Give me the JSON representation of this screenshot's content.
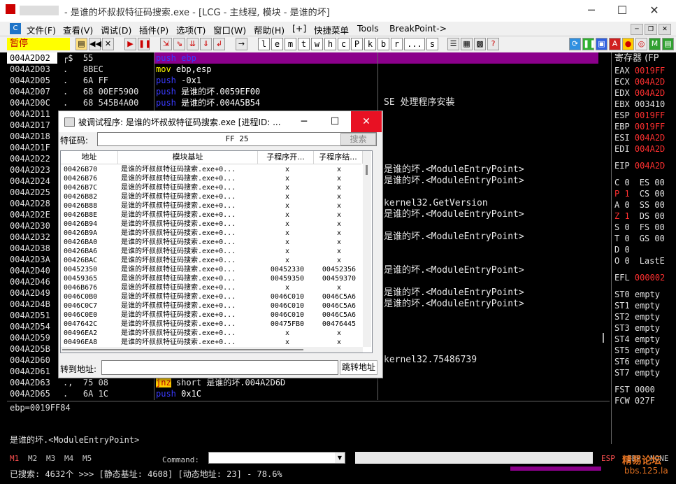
{
  "window": {
    "title": "- 是谁的坏叔叔特征码搜索.exe - [LCG - 主线程, 模块 - 是谁的坏]",
    "minimize": "─",
    "maximize": "☐",
    "close": "✕"
  },
  "menu": {
    "items": [
      "文件(F)",
      "查看(V)",
      "调试(D)",
      "插件(P)",
      "选项(T)",
      "窗口(W)",
      "帮助(H)",
      "[+]",
      "快捷菜单",
      "Tools",
      "BreakPoint->"
    ],
    "app_icon": "C"
  },
  "toolbar": {
    "status": "暂停",
    "letters": [
      "l",
      "e",
      "m",
      "t",
      "w",
      "h",
      "c",
      "P",
      "k",
      "b",
      "r",
      "...",
      "s"
    ]
  },
  "cpu": {
    "addresses": [
      "004A2D02",
      "004A2D03",
      "004A2D05",
      "004A2D07",
      "004A2D0C",
      "004A2D11",
      "004A2D17",
      "004A2D18",
      "004A2D1F",
      "004A2D22",
      "004A2D23",
      "004A2D24",
      "004A2D25",
      "004A2D28",
      "004A2D2E",
      "004A2D30",
      "004A2D32",
      "004A2D38",
      "004A2D3A",
      "004A2D40",
      "004A2D46",
      "004A2D49",
      "004A2D4B",
      "004A2D51",
      "004A2D54",
      "004A2D59",
      "004A2D5B",
      "004A2D60",
      "004A2D61",
      "004A2D63",
      "004A2D65"
    ],
    "hex": [
      "┌$  55",
      ".   8BEC",
      ".   6A FF",
      ".   68 00EF5900",
      ".   68 545B4A00",
      "",
      "",
      "",
      "",
      "",
      "",
      "",
      "",
      "",
      "",
      "",
      "",
      "",
      "",
      "",
      "",
      "",
      "",
      "",
      "",
      "",
      "",
      "",
      "",
      ".,  75 08",
      ".   6A 1C"
    ],
    "asm": [
      {
        "op": "push",
        "arg": " ebp"
      },
      {
        "op": "mov",
        "arg": " ebp,esp"
      },
      {
        "op": "push",
        "arg": " -0x1"
      },
      {
        "op": "push",
        "arg": " 是谁的坏.0059EF00"
      },
      {
        "op": "push",
        "arg": " 是谁的坏.004A5B54"
      }
    ],
    "asm_bottom": [
      {
        "op": "jnz",
        "arg": " short 是谁的坏.004A2D6D"
      },
      {
        "op": "push",
        "arg": " 0x1C"
      }
    ],
    "comments": [
      "",
      "",
      "",
      "",
      "SE 处理程序安装",
      "",
      "",
      "",
      "",
      "",
      "是谁的坏.<ModuleEntryPoint>",
      "是谁的坏.<ModuleEntryPoint>",
      "",
      "kernel32.GetVersion",
      "是谁的坏.<ModuleEntryPoint>",
      "",
      "是谁的坏.<ModuleEntryPoint>",
      "",
      "",
      "是谁的坏.<ModuleEntryPoint>",
      "",
      "是谁的坏.<ModuleEntryPoint>",
      "是谁的坏.<ModuleEntryPoint>",
      "",
      "",
      "",
      "",
      "kernel32.75486739",
      "",
      "",
      ""
    ]
  },
  "registers": {
    "header": "寄存器 (FP",
    "rows": [
      {
        "name": "EAX",
        "val": "0019FF",
        "red": true
      },
      {
        "name": "ECX",
        "val": "004A2D",
        "red": true
      },
      {
        "name": "EDX",
        "val": "004A2D",
        "red": true
      },
      {
        "name": "EBX",
        "val": "003410",
        "red": false
      },
      {
        "name": "ESP",
        "val": "0019FF",
        "red": true
      },
      {
        "name": "EBP",
        "val": "0019FF",
        "red": true
      },
      {
        "name": "ESI",
        "val": "004A2D",
        "red": true
      },
      {
        "name": "EDI",
        "val": "004A2D",
        "red": true
      }
    ],
    "eip": {
      "name": "EIP",
      "val": "004A2D"
    },
    "flags": [
      {
        "f": "C",
        "v": "0",
        "seg": "ES 00",
        "red": false
      },
      {
        "f": "P",
        "v": "1",
        "seg": "CS 00",
        "red": true
      },
      {
        "f": "A",
        "v": "0",
        "seg": "SS 00",
        "red": false
      },
      {
        "f": "Z",
        "v": "1",
        "seg": "DS 00",
        "red": true
      },
      {
        "f": "S",
        "v": "0",
        "seg": "FS 00",
        "red": false
      },
      {
        "f": "T",
        "v": "0",
        "seg": "GS 00",
        "red": false
      },
      {
        "f": "D",
        "v": "0",
        "seg": "",
        "red": false
      },
      {
        "f": "O",
        "v": "0",
        "seg": "LastE",
        "red": false
      }
    ],
    "efl": {
      "name": "EFL",
      "val": "000002"
    },
    "st": [
      "ST0 empty",
      "ST1 empty",
      "ST2 empty",
      "ST3 empty",
      "ST4 empty",
      "ST5 empty",
      "ST6 empty",
      "ST7 empty"
    ],
    "fst": "FST 0000",
    "fcw": "FCW 027F"
  },
  "info": {
    "line1": "ebp=0019FF84",
    "line2": "是谁的坏.<ModuleEntryPoint>"
  },
  "cmdbar": {
    "tabs": [
      "M1",
      "M2",
      "M3",
      "M4",
      "M5"
    ],
    "command_label": "Command:",
    "esp": "ESP",
    "ebp": "EBP",
    "none": "NONE"
  },
  "statusbar": {
    "text": "已搜索: 4632个 >>> [静态基址: 4608] [动态地址: 23] - 78.6%",
    "watermark": "精易论坛",
    "watermark2": "bbs.125.la"
  },
  "dialog": {
    "title": "被调试程序: 是谁的坏叔叔特征码搜索.exe [进程ID: ...",
    "sig_label": "特征码:",
    "sig_value": "FF 25",
    "search": "搜索",
    "columns": [
      "地址",
      "模块基址",
      "子程序开...",
      "子程序结..."
    ],
    "rows": [
      [
        "00426B70",
        "是谁的坏叔叔特征码搜索.exe+0...",
        "x",
        "x"
      ],
      [
        "00426B76",
        "是谁的坏叔叔特征码搜索.exe+0...",
        "x",
        "x"
      ],
      [
        "00426B7C",
        "是谁的坏叔叔特征码搜索.exe+0...",
        "x",
        "x"
      ],
      [
        "00426B82",
        "是谁的坏叔叔特征码搜索.exe+0...",
        "x",
        "x"
      ],
      [
        "00426B88",
        "是谁的坏叔叔特征码搜索.exe+0...",
        "x",
        "x"
      ],
      [
        "00426B8E",
        "是谁的坏叔叔特征码搜索.exe+0...",
        "x",
        "x"
      ],
      [
        "00426B94",
        "是谁的坏叔叔特征码搜索.exe+0...",
        "x",
        "x"
      ],
      [
        "00426B9A",
        "是谁的坏叔叔特征码搜索.exe+0...",
        "x",
        "x"
      ],
      [
        "00426BA0",
        "是谁的坏叔叔特征码搜索.exe+0...",
        "x",
        "x"
      ],
      [
        "00426BA6",
        "是谁的坏叔叔特征码搜索.exe+0...",
        "x",
        "x"
      ],
      [
        "00426BAC",
        "是谁的坏叔叔特征码搜索.exe+0...",
        "x",
        "x"
      ],
      [
        "00452350",
        "是谁的坏叔叔特征码搜索.exe+0...",
        "00452330",
        "00452356"
      ],
      [
        "00459365",
        "是谁的坏叔叔特征码搜索.exe+0...",
        "00459350",
        "00459370"
      ],
      [
        "0046B676",
        "是谁的坏叔叔特征码搜索.exe+0...",
        "x",
        "x"
      ],
      [
        "0046C0B0",
        "是谁的坏叔叔特征码搜索.exe+0...",
        "0046C010",
        "0046C5A6"
      ],
      [
        "0046C0C7",
        "是谁的坏叔叔特征码搜索.exe+0...",
        "0046C010",
        "0046C5A6"
      ],
      [
        "0046C0E0",
        "是谁的坏叔叔特征码搜索.exe+0...",
        "0046C010",
        "0046C5A6"
      ],
      [
        "0047642C",
        "是谁的坏叔叔特征码搜索.exe+0...",
        "00475FB0",
        "00476445"
      ],
      [
        "00496EA2",
        "是谁的坏叔叔特征码搜索.exe+0...",
        "x",
        "x"
      ],
      [
        "00496EA8",
        "是谁的坏叔叔特征码搜索.exe+0...",
        "x",
        "x"
      ]
    ],
    "goto_label": "转到地址:",
    "goto_btn": "跳转地址"
  }
}
